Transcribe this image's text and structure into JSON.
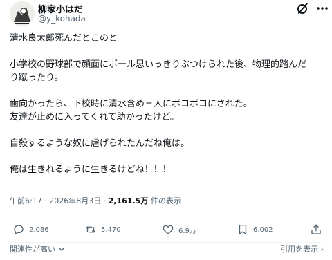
{
  "author": {
    "display_name": "柳家小はだ",
    "handle": "@y_kohada"
  },
  "post": {
    "lines": [
      "清水良太郎死んだとこのと",
      "",
      "小学校の野球部で顔面にボール思いっきりぶつけられた後、物理的踏んだ",
      "り蹴ったり。",
      "",
      "歯向かったら、下校時に清水含め三人にボコボコにされた。",
      "友達が止めに入ってくれて助かったけど。",
      "",
      "自殺するような奴に虐げられたんだね俺は。",
      "",
      "俺は生きれるように生きるけどね！！！"
    ]
  },
  "meta": {
    "time": "午前6:17",
    "separator": "·",
    "date": "2026年8月3日",
    "views_count": "2,161.5万",
    "views_label": "件の表示"
  },
  "actions": {
    "replies": "2,086",
    "reposts": "5,470",
    "likes": "6.9万",
    "bookmarks": "6,002"
  },
  "footer": {
    "sort_label": "関連性が高い",
    "quote_label": "引用を表示 ›"
  },
  "icons": [
    "avatar",
    "grok-icon",
    "more-icon",
    "reply-icon",
    "repost-icon",
    "like-icon",
    "bookmark-icon",
    "share-icon",
    "chevron-down-icon"
  ],
  "colors": {
    "text": "#0f1419",
    "secondary": "#536471",
    "divider": "#eff3f4"
  }
}
